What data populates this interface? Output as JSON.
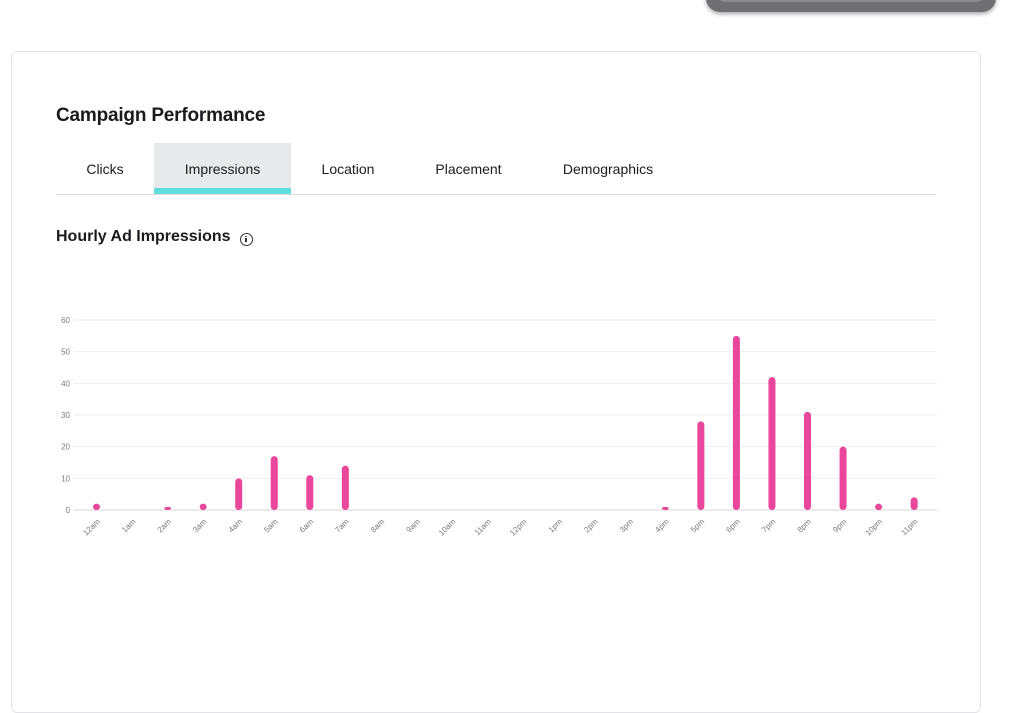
{
  "header": {
    "title": "Campaign Performance"
  },
  "tabs": [
    {
      "label": "Clicks",
      "active": false
    },
    {
      "label": "Impressions",
      "active": true
    },
    {
      "label": "Location",
      "active": false
    },
    {
      "label": "Placement",
      "active": false
    },
    {
      "label": "Demographics",
      "active": false
    }
  ],
  "colors": {
    "bar": "#e8479b",
    "tab_indicator": "#5fdfdb",
    "grid": "#eeeeef"
  },
  "info_icon": "info-icon",
  "chart_data": {
    "type": "bar",
    "title": "Hourly Ad Impressions",
    "categories": [
      "12am",
      "1am",
      "2am",
      "3am",
      "4am",
      "5am",
      "6am",
      "7am",
      "8am",
      "9am",
      "10am",
      "11am",
      "12pm",
      "1pm",
      "2pm",
      "3pm",
      "4pm",
      "5pm",
      "6pm",
      "7pm",
      "8pm",
      "9pm",
      "10pm",
      "11pm"
    ],
    "values": [
      2,
      0,
      1,
      2,
      10,
      17,
      11,
      14,
      0,
      0,
      0,
      0,
      0,
      0,
      0,
      0,
      1,
      28,
      55,
      42,
      31,
      20,
      2,
      4
    ],
    "yticks": [
      0,
      10,
      20,
      30,
      40,
      50,
      60
    ],
    "ylim": [
      0,
      60
    ],
    "xlabel": "",
    "ylabel": "",
    "grid": true,
    "legend": "none"
  }
}
